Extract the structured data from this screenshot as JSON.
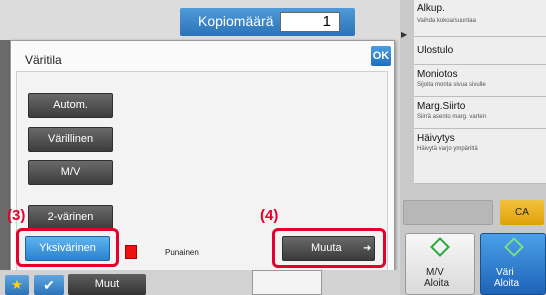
{
  "copies": {
    "label": "Kopiomäärä",
    "value": "1"
  },
  "dialog": {
    "title": "Väritila",
    "ok_label": "OK",
    "options": [
      "Autom.",
      "Värillinen",
      "M/V",
      "2-värinen",
      "Yksivärinen"
    ],
    "selected_option": "Yksivärinen",
    "color_name": "Punainen",
    "color_hex": "#e11111",
    "change_label": "Muuta"
  },
  "steps": {
    "step3": "(3)",
    "step4": "(4)"
  },
  "right_menu": [
    {
      "title": "Alkup.",
      "subtitle": "Vaihda kokoa/suuntaa"
    },
    {
      "title": "Ulostulo",
      "subtitle": ""
    },
    {
      "title": "Moniotos",
      "subtitle": "Sijoita monta sivua sivulle"
    },
    {
      "title": "Marg.Siirto",
      "subtitle": "Siirrä asento marg. varten"
    },
    {
      "title": "Häivytys",
      "subtitle": "Häivytä varjo ympäriltä"
    }
  ],
  "controls": {
    "ca_label": "CA",
    "start_bw": {
      "line1": "M/V",
      "line2": "Aloita"
    },
    "start_color": {
      "line1": "Väri",
      "line2": "Aloita"
    },
    "others_label": "Muut"
  },
  "colors": {
    "accent_blue": "#2b82cf",
    "highlight_red": "#e4002b",
    "ca_yellow": "#f2c23d"
  }
}
